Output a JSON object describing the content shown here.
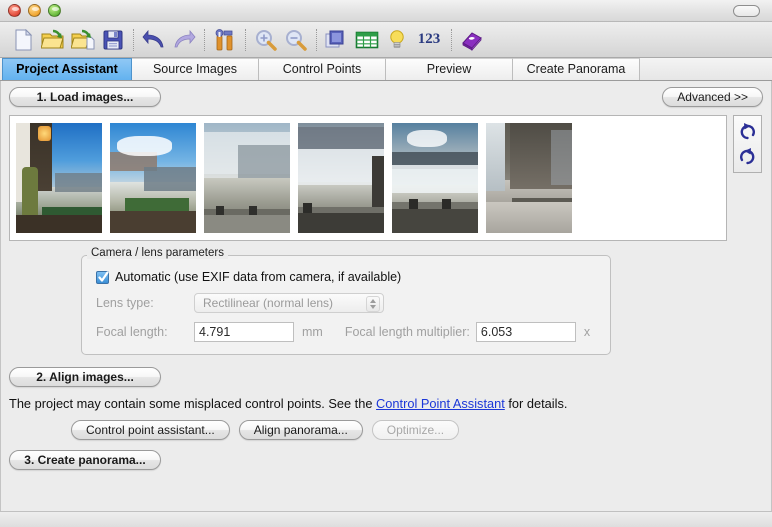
{
  "window": {
    "controls": [
      "close",
      "minimize",
      "zoom"
    ],
    "toolbar_toggle": "toolbar-pill"
  },
  "toolbar": {
    "items": [
      {
        "name": "new-project-icon",
        "label": "New"
      },
      {
        "name": "open-project-icon",
        "label": "Open"
      },
      {
        "name": "save-project-icon",
        "label": "Save as"
      },
      {
        "name": "save-icon",
        "label": "Save"
      },
      {
        "name": "undo-icon",
        "label": "Undo"
      },
      {
        "name": "redo-icon",
        "label": "Redo"
      },
      {
        "name": "tools-icon",
        "label": "Preferences"
      },
      {
        "name": "zoom-in-icon",
        "label": "Zoom in"
      },
      {
        "name": "zoom-out-icon",
        "label": "Zoom out"
      },
      {
        "name": "images-icon",
        "label": "Show all images"
      },
      {
        "name": "grid-icon",
        "label": "Show control points table"
      },
      {
        "name": "hint-icon",
        "label": "Show hints"
      },
      {
        "name": "numbers-icon",
        "label": "123"
      },
      {
        "name": "book-icon",
        "label": "Help"
      }
    ],
    "numbers_label": "123"
  },
  "tabs": [
    {
      "label": "Project Assistant",
      "selected": true
    },
    {
      "label": "Source Images",
      "selected": false
    },
    {
      "label": "Control Points",
      "selected": false
    },
    {
      "label": "Preview",
      "selected": false
    },
    {
      "label": "Create Panorama",
      "selected": false
    }
  ],
  "assistant": {
    "load_images_label": "1. Load images...",
    "advanced_label": "Advanced >>",
    "align_images_label": "2. Align images...",
    "create_panorama_label": "3. Create panorama...",
    "hint_prefix": "The project may contain some misplaced control points. See the",
    "hint_link": "Control Point Assistant",
    "hint_suffix": "for details.",
    "buttons": [
      {
        "label": "Control point assistant...",
        "name": "control-point-assistant-button",
        "disabled": false
      },
      {
        "label": "Align panorama...",
        "name": "align-panorama-button",
        "disabled": false
      },
      {
        "label": "Optimize...",
        "name": "optimize-button",
        "disabled": true
      }
    ]
  },
  "thumbnails": {
    "count": 6,
    "rotate_ccw_label": "Rotate counterclockwise",
    "rotate_cw_label": "Rotate clockwise",
    "items": [
      {
        "name": "thumbnail-image-1",
        "sky": "#2f86d0",
        "land": "#5f6b4a",
        "desc": "Lodge balcony overlooking falls"
      },
      {
        "name": "thumbnail-image-2",
        "sky": "#2f86d0",
        "land": "#6c7a58",
        "desc": "Falls edge with green lawn"
      },
      {
        "name": "thumbnail-image-3",
        "sky": "#9fb4c6",
        "land": "#8b8b84",
        "desc": "Mist over falls with railing"
      },
      {
        "name": "thumbnail-image-4",
        "sky": "#8395a5",
        "land": "#7e8076",
        "desc": "Heavy mist and cloud"
      },
      {
        "name": "thumbnail-image-5",
        "sky": "#7d93a8",
        "land": "#9a9a92",
        "desc": "Horseshoe falls with clouds"
      },
      {
        "name": "thumbnail-image-6",
        "sky": "#6d6a62",
        "land": "#a8a49d",
        "desc": "Rock wall and snow"
      }
    ]
  },
  "camera_group": {
    "legend": "Camera / lens parameters",
    "automatic_label": "Automatic (use EXIF data from camera, if available)",
    "automatic_checked": true,
    "lens_type_label": "Lens type:",
    "lens_type_value": "Rectilinear (normal lens)",
    "focal_length_label": "Focal length:",
    "focal_length_value": "4.791",
    "focal_length_unit": "mm",
    "multiplier_label": "Focal length multiplier:",
    "multiplier_value": "6.053",
    "multiplier_unit": "x"
  },
  "colors": {
    "tab_selected": "#63b2ef",
    "link": "#1b37d8",
    "window_bg": "#ececec"
  }
}
